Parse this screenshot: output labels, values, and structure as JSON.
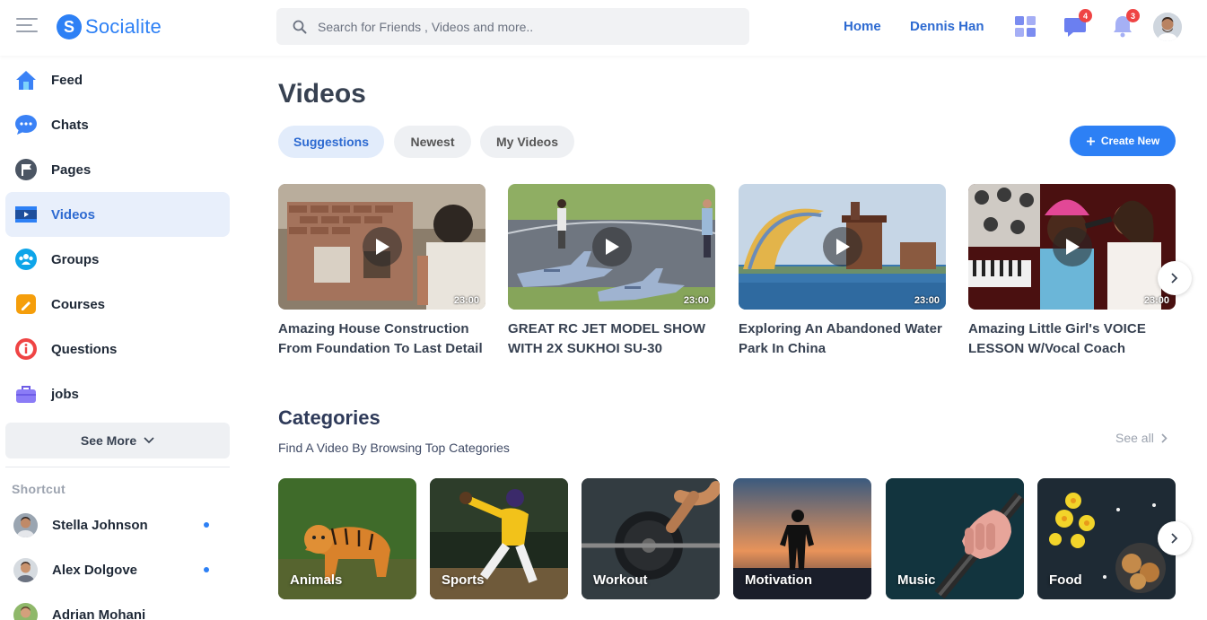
{
  "header": {
    "brand_letter": "S",
    "brand_name": "Socialite",
    "search_placeholder": "Search for Friends , Videos and more..",
    "nav": [
      "Home",
      "Dennis Han"
    ],
    "message_badge": "4",
    "notification_badge": "3",
    "accent_color": "#2d80f5"
  },
  "sidebar": {
    "items": [
      {
        "label": "Feed",
        "icon": "home-icon"
      },
      {
        "label": "Chats",
        "icon": "chat-icon"
      },
      {
        "label": "Pages",
        "icon": "flag-icon"
      },
      {
        "label": "Videos",
        "icon": "video-icon",
        "active": true
      },
      {
        "label": "Groups",
        "icon": "groups-icon"
      },
      {
        "label": "Courses",
        "icon": "courses-icon"
      },
      {
        "label": "Questions",
        "icon": "info-icon"
      },
      {
        "label": "jobs",
        "icon": "briefcase-icon"
      }
    ],
    "see_more": "See More",
    "shortcut_title": "Shortcut",
    "contacts": [
      {
        "name": "Stella Johnson",
        "online": true
      },
      {
        "name": "Alex Dolgove",
        "online": true
      },
      {
        "name": "Adrian Mohani",
        "online": false
      }
    ]
  },
  "main": {
    "title": "Videos",
    "tabs": [
      "Suggestions",
      "Newest",
      "My Videos"
    ],
    "create_button": "Create New",
    "videos": [
      {
        "title": "Amazing House Construction From Foundation To Last Detail",
        "duration": "23:00"
      },
      {
        "title": "GREAT RC JET MODEL SHOW WITH 2X SUKHOI SU-30",
        "duration": "23:00"
      },
      {
        "title": "Exploring An Abandoned Water Park In China",
        "duration": "23:00"
      },
      {
        "title": "Amazing Little Girl's VOICE LESSON W/Vocal Coach",
        "duration": "23:00"
      }
    ],
    "categories_title": "Categories",
    "categories_subtitle": "Find A Video By Browsing Top Categories",
    "see_all": "See all",
    "categories": [
      "Animals",
      "Sports",
      "Workout",
      "Motivation",
      "Music",
      "Food"
    ]
  }
}
